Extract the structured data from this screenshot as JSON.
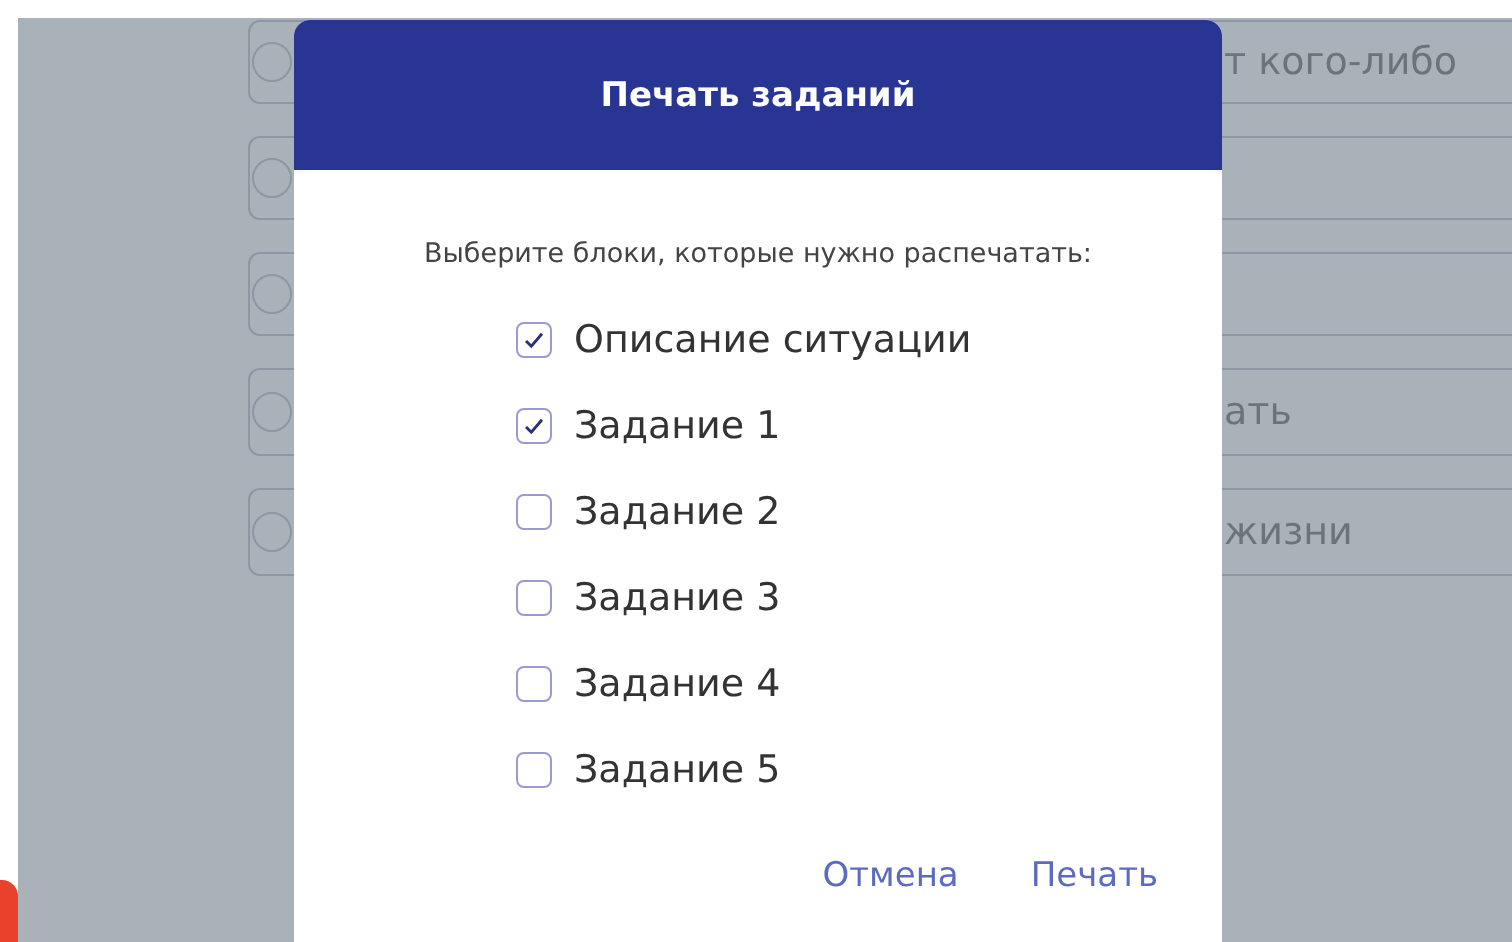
{
  "background_options": [
    {
      "text": "т кого-либо",
      "selected": false
    },
    {
      "selected": false
    },
    {
      "selected": false
    },
    {
      "text": "ать",
      "selected": false
    },
    {
      "text": "жизни",
      "selected": false
    }
  ],
  "dialog": {
    "title": "Печать заданий",
    "prompt": "Выберите блоки, которые нужно распечатать:",
    "items": [
      {
        "label": "Описание ситуации",
        "checked": true
      },
      {
        "label": "Задание 1",
        "checked": true
      },
      {
        "label": "Задание 2",
        "checked": false
      },
      {
        "label": "Задание 3",
        "checked": false
      },
      {
        "label": "Задание 4",
        "checked": false
      },
      {
        "label": "Задание 5",
        "checked": false
      }
    ],
    "buttons": [
      "Отмена",
      "Печать"
    ]
  }
}
